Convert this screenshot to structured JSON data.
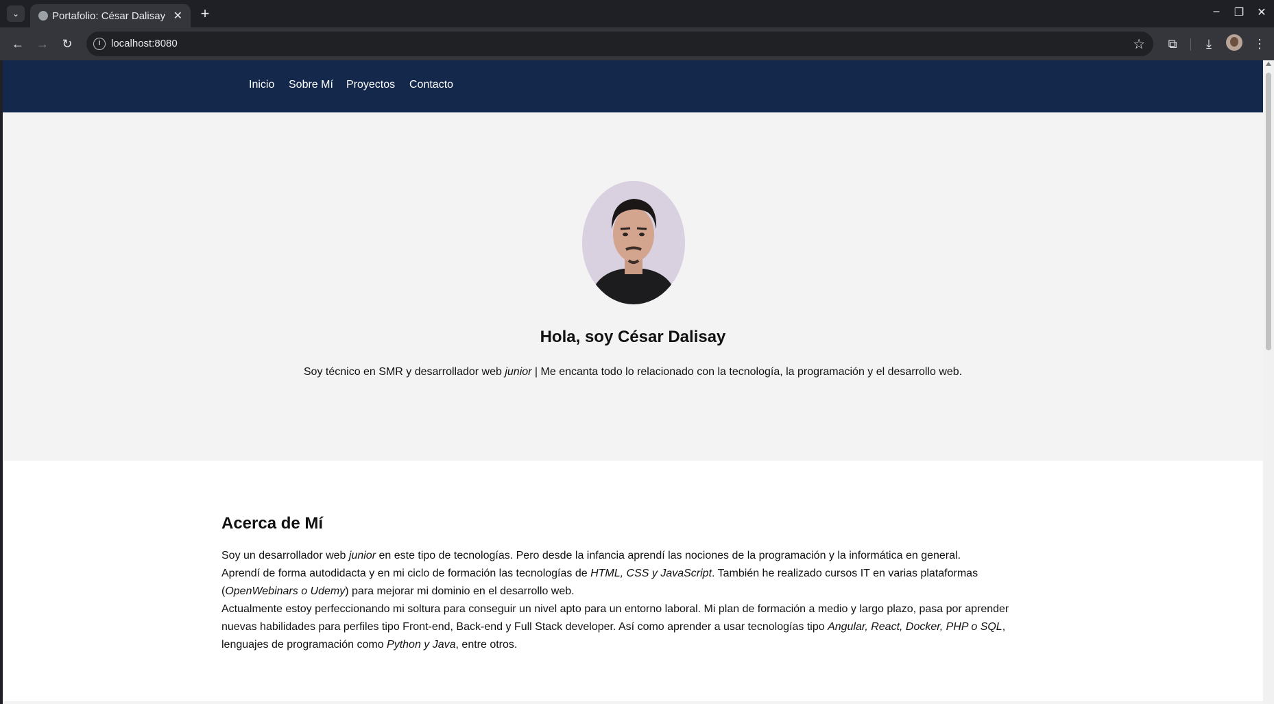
{
  "browser": {
    "tab_title": "Portafolio: César Dalisay",
    "url": "localhost:8080"
  },
  "nav": {
    "items": [
      "Inicio",
      "Sobre Mí",
      "Proyectos",
      "Contacto"
    ]
  },
  "hero": {
    "title": "Hola, soy César Dalisay",
    "subtitle_1": "Soy técnico en SMR y desarrollador web ",
    "subtitle_em": "junior",
    "subtitle_2": " | Me encanta todo lo relacionado con la tecnología, la programación y el desarrollo web."
  },
  "about": {
    "title": "Acerca de Mí",
    "p1_a": "Soy un desarrollador web ",
    "p1_em": "junior",
    "p1_b": " en este tipo de tecnologías. Pero desde la infancia aprendí las nociones de la programación y la informática en general.",
    "p2_a": "Aprendí de forma autodidacta y en mi ciclo de formación las tecnologías de ",
    "p2_em1": "HTML, CSS y JavaScript",
    "p2_b": ". También he realizado cursos IT en varias plataformas (",
    "p2_em2": "OpenWebinars o Udemy",
    "p2_c": ") para mejorar mi dominio en el desarrollo web.",
    "p3_a": "Actualmente estoy perfeccionando mi soltura para conseguir un nivel apto para un entorno laboral. Mi plan de formación a medio y largo plazo, pasa por aprender nuevas habilidades para perfiles tipo Front-end, Back-end y Full Stack developer. Así como aprender a usar tecnologías tipo ",
    "p3_em1": "Angular, React, Docker, PHP o SQL",
    "p3_b": ", lenguajes de programación como ",
    "p3_em2": "Python y Java",
    "p3_c": ", entre otros."
  },
  "colors": {
    "nav_bg": "#14284b",
    "hero_bg": "#f3f3f3"
  },
  "icons": [
    "tab-search-icon",
    "globe-icon",
    "close-icon",
    "plus-icon",
    "minimize-icon",
    "maximize-icon",
    "back-icon",
    "forward-icon",
    "reload-icon",
    "info-icon",
    "star-icon",
    "extensions-icon",
    "download-icon",
    "profile-avatar",
    "kebab-menu-icon"
  ]
}
